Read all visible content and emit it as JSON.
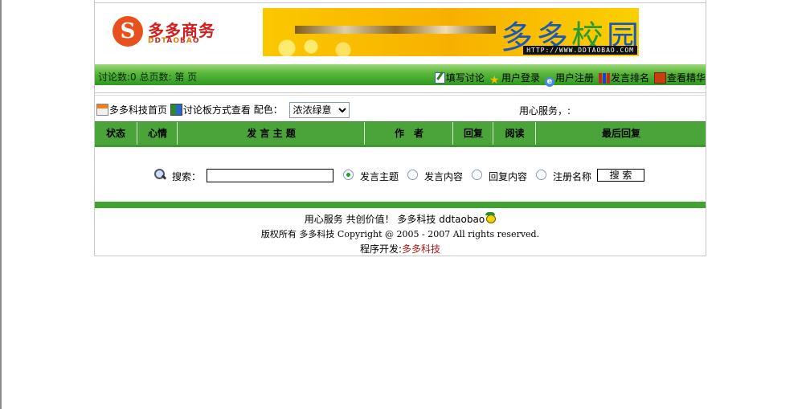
{
  "logo": {
    "name": "多多商务",
    "sub": "DDTAOBAO"
  },
  "banner": {
    "title_chars": [
      "多",
      "多",
      "校",
      "园"
    ],
    "url": "HTTP://WWW.DDTAOBAO.COM"
  },
  "stats": {
    "text": "讨论数:0 总页数:  第 页"
  },
  "toplinks": [
    {
      "icon": "edit-icon",
      "label": "填写讨论"
    },
    {
      "icon": "star-icon",
      "label": "用户登录"
    },
    {
      "icon": "ie-icon",
      "label": "用户注册"
    },
    {
      "icon": "rank-icon",
      "label": "发言排名"
    },
    {
      "icon": "book-icon",
      "label": "查看精华"
    }
  ],
  "nav": {
    "home_label": "多多科技首页",
    "board_label": "讨论板方式查看",
    "scheme_label": "配色：",
    "scheme_value": "浓浓绿意",
    "service": "用心服务，:"
  },
  "table": {
    "headers": [
      "状态",
      "心情",
      "发 言 主 题",
      "作　者",
      "回复",
      "阅读",
      "最后回复"
    ]
  },
  "search": {
    "label": "搜索：",
    "value": "",
    "options": [
      "发言主题",
      "发言内容",
      "回复内容",
      "注册名称"
    ],
    "selected": 0,
    "button": "搜 索"
  },
  "footer": {
    "line1": "用心服务 共创价值！ 多多科技 ddtaobao",
    "line2": "版权所有 多多科技 Copyright @ 2005 - 2007 All rights reserved.",
    "dev_label": "程序开发:",
    "dev_name": "多多科技"
  },
  "colors": {
    "green": "#4aa43a",
    "accent_red": "#b01818"
  }
}
